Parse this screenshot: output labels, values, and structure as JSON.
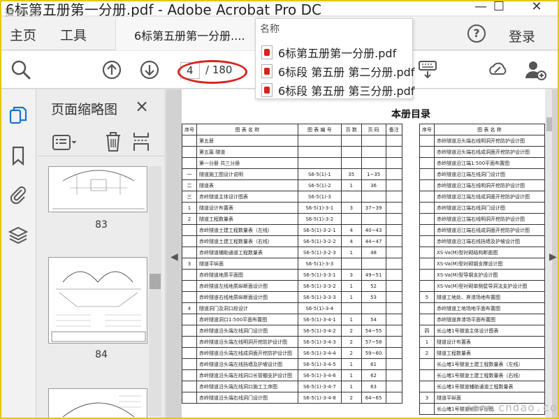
{
  "window": {
    "title": "6标第五册第一分册.pdf - Adobe Acrobat Pro DC",
    "watermark_top": "道桥网",
    "watermark_bottom": "www.cndao.com",
    "minimize": "—",
    "maximize": "☐",
    "close": "✕"
  },
  "menubar": {
    "home": "主页",
    "tools": "工具",
    "doc_tab": "6标第五册第一分册....",
    "tab_close": "×",
    "help": "?",
    "login": "登录"
  },
  "toolbar": {
    "page_current": "4",
    "page_total": "/ 180",
    "icons": [
      "search-zoom-icon",
      "arrow-up-icon",
      "arrow-down-icon",
      "keyboard-icon",
      "cloud-link-icon",
      "add-user-icon"
    ]
  },
  "dropdown": {
    "header": "名称",
    "items": [
      {
        "label": "6标第五册第一分册.pdf"
      },
      {
        "label": "6标段 第五册  第二分册.pdf"
      },
      {
        "label": "6标段 第五册  第三分册.pdf"
      }
    ]
  },
  "thumb_panel": {
    "title": "页面缩略图",
    "close": "×",
    "thumbnails": [
      {
        "num": "83"
      },
      {
        "num": "84"
      }
    ]
  },
  "document": {
    "title": "本册目录",
    "left_header": [
      "序号",
      "图 表 名 称",
      "图 表 编 号",
      "页 数",
      "页 码",
      "备注"
    ],
    "left_rows": [
      [
        "",
        "第五册",
        "",
        "",
        "",
        ""
      ],
      [
        "",
        "第五篇  隧道",
        "",
        "",
        "",
        ""
      ],
      [
        "",
        "第一分册  共三分册",
        "",
        "",
        "",
        ""
      ],
      [
        "一",
        "隧道施工图设计说明",
        "S6-5(1)-1",
        "35",
        "1~35",
        ""
      ],
      [
        "二",
        "隧道表",
        "S6-5(1)-2",
        "1",
        "36",
        ""
      ],
      [
        "三",
        "赤岭隧道主体设计图表",
        "S6-5(1)-3",
        "",
        "",
        ""
      ],
      [
        "1",
        "隧道设计布置表",
        "S6-5(1)-3-1",
        "3",
        "37~39",
        ""
      ],
      [
        "2",
        "隧道工程数量表",
        "S6-5(1)-3-2",
        "",
        "",
        ""
      ],
      [
        "",
        "赤岭隧道土建工程数量表（左线）",
        "S6-5(1)-3-2-1",
        "4",
        "40~43",
        ""
      ],
      [
        "",
        "赤岭隧道土建工程数量表（右线）",
        "S6-5(1)-3-2-2",
        "4",
        "44~47",
        ""
      ],
      [
        "",
        "赤岭隧道辅助通道工程数量表",
        "S6-5(1)-3-2-3",
        "1",
        "48",
        ""
      ],
      [
        "3",
        "隧道平纵面",
        "S6-5(1)-3-3",
        "",
        "",
        ""
      ],
      [
        "",
        "赤岭隧道地质平面图",
        "S6-5(1)-3-3-1",
        "3",
        "49~51",
        ""
      ],
      [
        "",
        "赤岭隧道左线地质纵断面设计图",
        "S6-5(1)-3-3-2",
        "1",
        "52",
        ""
      ],
      [
        "",
        "赤岭隧道右线地质纵断面设计图",
        "S6-5(1)-3-3-3",
        "1",
        "53",
        ""
      ],
      [
        "4",
        "隧道洞门及洞口段设计",
        "S6-5(1)-3-4",
        "",
        "",
        ""
      ],
      [
        "",
        "赤岭隧道洞口1:500平面布置图",
        "S6-5(1)-3-4-1",
        "1",
        "54",
        ""
      ],
      [
        "",
        "赤岭隧道沿头端左线洞门设计图",
        "S6-5(1)-3-4-2",
        "2",
        "54~55",
        ""
      ],
      [
        "",
        "赤岭隧道沿头端左线明洞开挖防护设计图",
        "S6-5(1)-3-4-3",
        "2",
        "57~58",
        ""
      ],
      [
        "",
        "赤岭隧道沿头端左线成洞面开挖防护设计图",
        "S6-5(1)-3-4-4",
        "2",
        "59~60",
        ""
      ],
      [
        "",
        "赤岭隧道沿头端左线挡墙及护坡设计图",
        "S6-5(1)-3-4-5",
        "1",
        "61",
        ""
      ],
      [
        "",
        "赤岭隧道沿头端左线洞口长管棚支护设计图",
        "S6-5(1)-3-4-6",
        "1",
        "62",
        ""
      ],
      [
        "",
        "赤岭隧道沿头端左线洞口施工工序图",
        "S6-5(1)-3-4-7",
        "1",
        "63",
        ""
      ],
      [
        "",
        "赤岭隧道沿头端右线洞门设计图",
        "S6-5(1)-3-4-8",
        "2",
        "64~65",
        ""
      ]
    ],
    "right_header": [
      "序号",
      "图 表 名 称"
    ],
    "right_rows": [
      [
        "",
        "赤岭隧道沿头端右线明洞开挖防护设计图"
      ],
      [
        "",
        "赤岭隧道沿头端右线成洞面开挖防护设计图"
      ],
      [
        "",
        "赤岭隧道沿江端1:500平面布置图"
      ],
      [
        "",
        "赤岭隧道沿江端左线洞门设计图"
      ],
      [
        "",
        "赤岭隧道沿江端左线明洞开挖防护设计图"
      ],
      [
        "",
        "赤岭隧道沿江端左线成洞面开挖防护设计图"
      ],
      [
        "",
        "赤岭隧道沿江端右线洞门设计图"
      ],
      [
        "",
        "赤岭隧道沿江端右线明洞开挖防护设计图"
      ],
      [
        "",
        "赤岭隧道沿江端右线成洞面开挖防护设计图"
      ],
      [
        "",
        "赤岭隧道沿江端右线挡墙及护坡设计图"
      ],
      [
        "",
        "XS-Va(M)型衬砌结构断面图"
      ],
      [
        "",
        "XS-Va(M)型衬砌钢支撑设计图"
      ],
      [
        "",
        "XS-Va(M)型导钢支护设计图"
      ],
      [
        "",
        "XS-Va(M)型衬砌单侧壁导洞法支护设计图"
      ],
      [
        "5",
        "隧道工地处、弃渣场地布置图"
      ],
      [
        "",
        "赤岭隧道工地场地平面布置图"
      ],
      [
        "",
        "赤岭隧道弃渣场平面布置图"
      ],
      [
        "四",
        "长山堵1号隧道主体设计图表"
      ],
      [
        "1",
        "隧道设计布置表"
      ],
      [
        "2",
        "隧道工程数量表"
      ],
      [
        "",
        "长山堵1号隧道土建工程数量表（左线）"
      ],
      [
        "",
        "长山堵1号隧道土建工程数量表（右线）"
      ],
      [
        "",
        "长山堵1号隧道辅助通道工程数量表"
      ],
      [
        "3",
        "隧道平纵面"
      ],
      [
        "",
        "长山堵1号隧道地质平面图"
      ]
    ]
  }
}
